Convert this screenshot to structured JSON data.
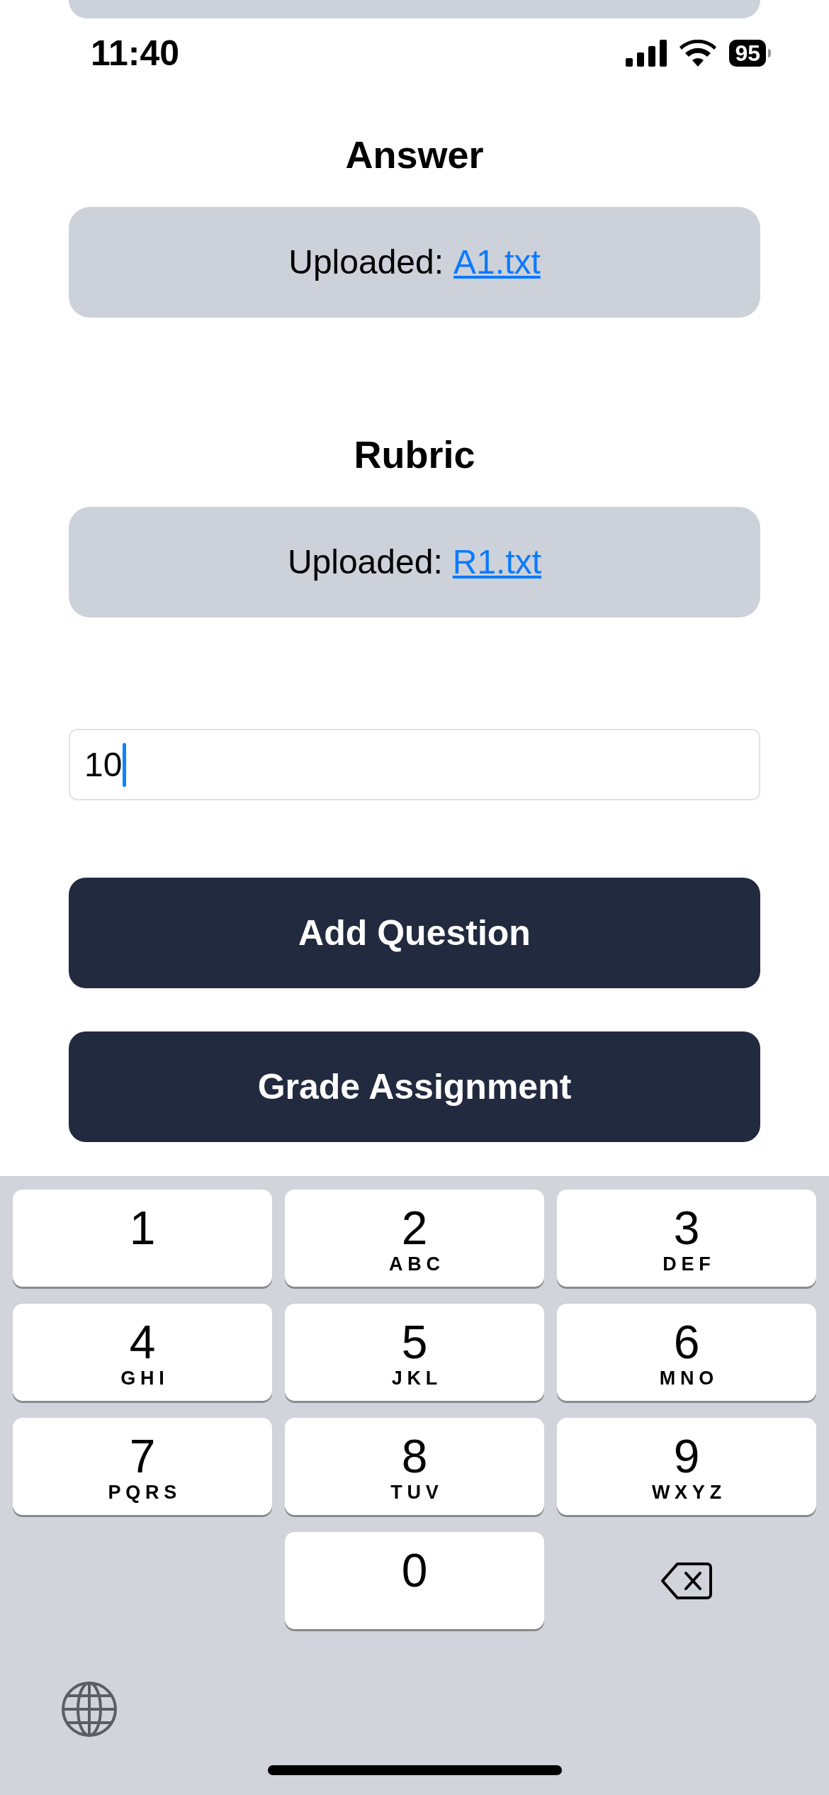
{
  "status_bar": {
    "time": "11:40",
    "battery": "95"
  },
  "sections": [
    {
      "heading": "Answer",
      "label": "Uploaded:",
      "file": "A1.txt"
    },
    {
      "heading": "Rubric",
      "label": "Uploaded:",
      "file": "R1.txt"
    }
  ],
  "points_field": {
    "value": "10"
  },
  "buttons": [
    "Add Question",
    "Grade Assignment"
  ],
  "keyboard": {
    "keys": [
      {
        "kind": "digit",
        "digit": "1"
      },
      {
        "kind": "digit",
        "digit": "2",
        "letters": "ABC"
      },
      {
        "kind": "digit",
        "digit": "3",
        "letters": "DEF"
      },
      {
        "kind": "digit",
        "digit": "4",
        "letters": "GHI"
      },
      {
        "kind": "digit",
        "digit": "5",
        "letters": "JKL"
      },
      {
        "kind": "digit",
        "digit": "6",
        "letters": "MNO"
      },
      {
        "kind": "digit",
        "digit": "7",
        "letters": "PQRS"
      },
      {
        "kind": "digit",
        "digit": "8",
        "letters": "TUV"
      },
      {
        "kind": "digit",
        "digit": "9",
        "letters": "WXYZ"
      },
      {
        "kind": "blank"
      },
      {
        "kind": "digit",
        "digit": "0"
      },
      {
        "kind": "delete"
      }
    ]
  }
}
